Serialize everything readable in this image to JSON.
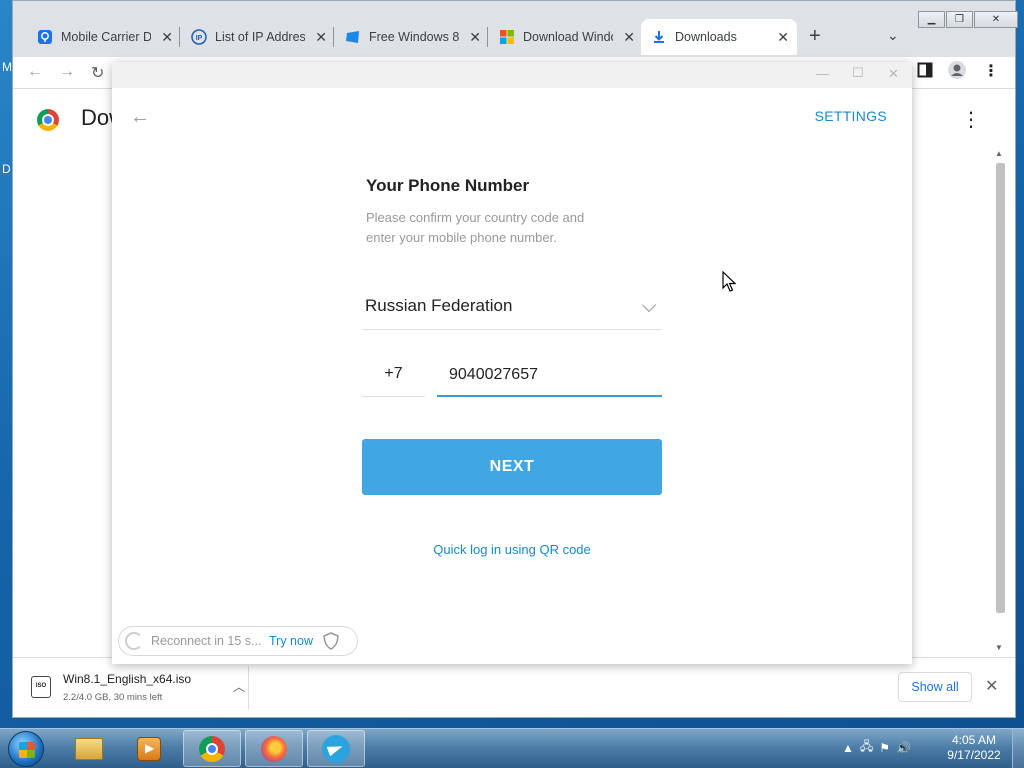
{
  "desktop": {
    "left_letters": [
      "M",
      "D"
    ]
  },
  "browser": {
    "tabs": [
      {
        "title": "Mobile Carrier Detector",
        "icon": "location-pin-icon"
      },
      {
        "title": "List of IP Addresses",
        "icon": "ip-icon"
      },
      {
        "title": "Free Windows 8",
        "icon": "windows-blue-icon"
      },
      {
        "title": "Download Windows",
        "icon": "microsoft-logo-icon"
      },
      {
        "title": "Downloads",
        "icon": "download-icon"
      }
    ],
    "new_tab_label": "+",
    "page_title": "Dow",
    "download": {
      "filename": "Win8.1_English_x64.iso",
      "status": "2.2/4.0 GB, 30 mins left",
      "show_all": "Show all"
    }
  },
  "telegram": {
    "settings_label": "SETTINGS",
    "heading": "Your Phone Number",
    "description": "Please confirm your country code and enter your mobile phone number.",
    "country": "Russian Federation",
    "country_code": "+7",
    "phone_number": "9040027657",
    "next_label": "NEXT",
    "qr_link": "Quick log in using QR code",
    "reconnect_text": "Reconnect in 15 s...",
    "try_now": "Try now"
  },
  "taskbar": {
    "time": "4:05 AM",
    "date": "9/17/2022",
    "apps": [
      "file-explorer",
      "media-player",
      "chrome",
      "firefox",
      "telegram"
    ]
  },
  "colors": {
    "telegram_accent": "#40a7e3",
    "link_blue": "#168acd"
  }
}
